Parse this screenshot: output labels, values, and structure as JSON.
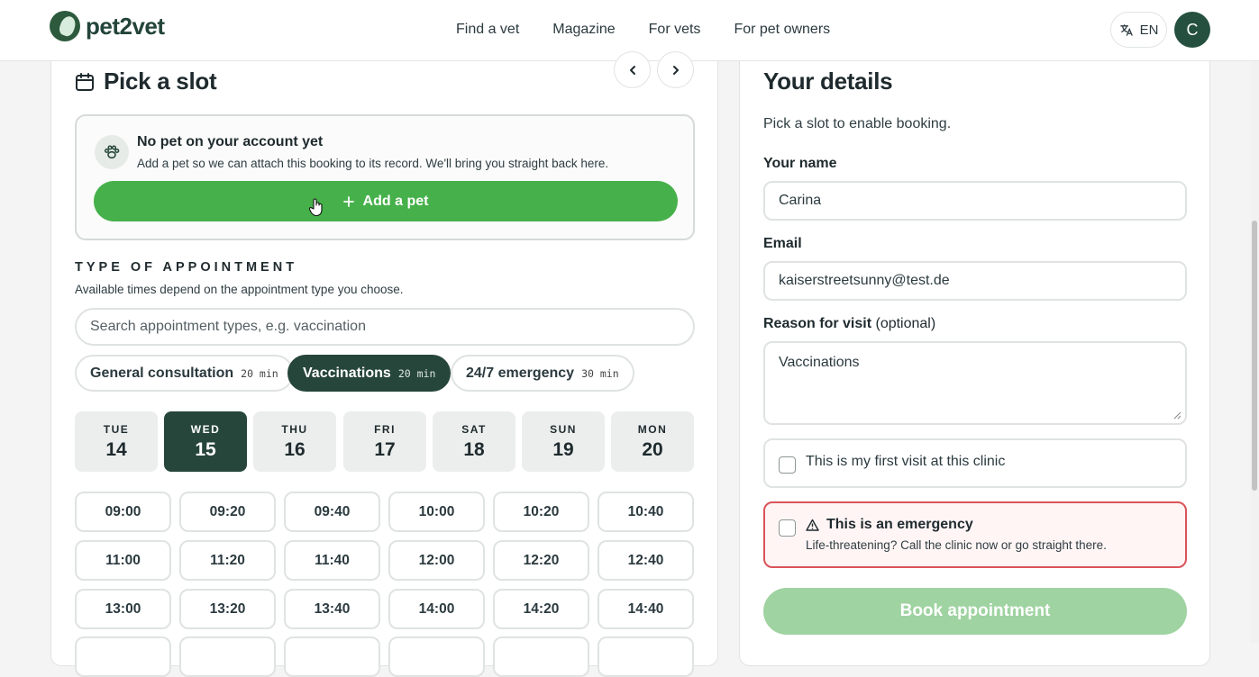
{
  "header": {
    "logo_text": "pet2vet",
    "nav": [
      "Find a vet",
      "Magazine",
      "For vets",
      "For pet owners"
    ],
    "language": "EN",
    "avatar_initial": "C"
  },
  "slot_panel": {
    "title": "Pick a slot",
    "no_pet": {
      "title": "No pet on your account yet",
      "text": "Add a pet so we can attach this booking to its record. We'll bring you straight back here.",
      "button": "Add a pet"
    },
    "type_heading": "TYPE OF APPOINTMENT",
    "type_sub": "Available times depend on the appointment type you choose.",
    "search_placeholder": "Search appointment types, e.g. vaccination",
    "types": [
      {
        "name": "General consultation",
        "duration": "20 min"
      },
      {
        "name": "Vaccinations",
        "duration": "20 min"
      },
      {
        "name": "24/7 emergency",
        "duration": "30 min"
      }
    ],
    "days": [
      {
        "dow": "TUE",
        "num": "14"
      },
      {
        "dow": "WED",
        "num": "15"
      },
      {
        "dow": "THU",
        "num": "16"
      },
      {
        "dow": "FRI",
        "num": "17"
      },
      {
        "dow": "SAT",
        "num": "18"
      },
      {
        "dow": "SUN",
        "num": "19"
      },
      {
        "dow": "MON",
        "num": "20"
      }
    ],
    "slots": [
      "09:00",
      "09:20",
      "09:40",
      "10:00",
      "10:20",
      "10:40",
      "11:00",
      "11:20",
      "11:40",
      "12:00",
      "12:20",
      "12:40",
      "13:00",
      "13:20",
      "13:40",
      "14:00",
      "14:20",
      "14:40"
    ]
  },
  "details_panel": {
    "title": "Your details",
    "hint": "Pick a slot to enable booking.",
    "name_label": "Your name",
    "name_value": "Carina",
    "email_label": "Email",
    "email_value": "kaiserstreetsunny@test.de",
    "reason_label": "Reason for visit",
    "reason_optional": "(optional)",
    "reason_value": "Vaccinations",
    "first_visit_label": "This is my first visit at this clinic",
    "emergency_label": "This is an emergency",
    "emergency_sub": "Life-threatening? Call the clinic now or go straight there.",
    "book_button": "Book appointment"
  },
  "colors": {
    "brand_dark": "#27463b",
    "primary_green": "#46b04a",
    "disabled_green": "#9fd3a1",
    "emergency_red": "#d9545a"
  }
}
